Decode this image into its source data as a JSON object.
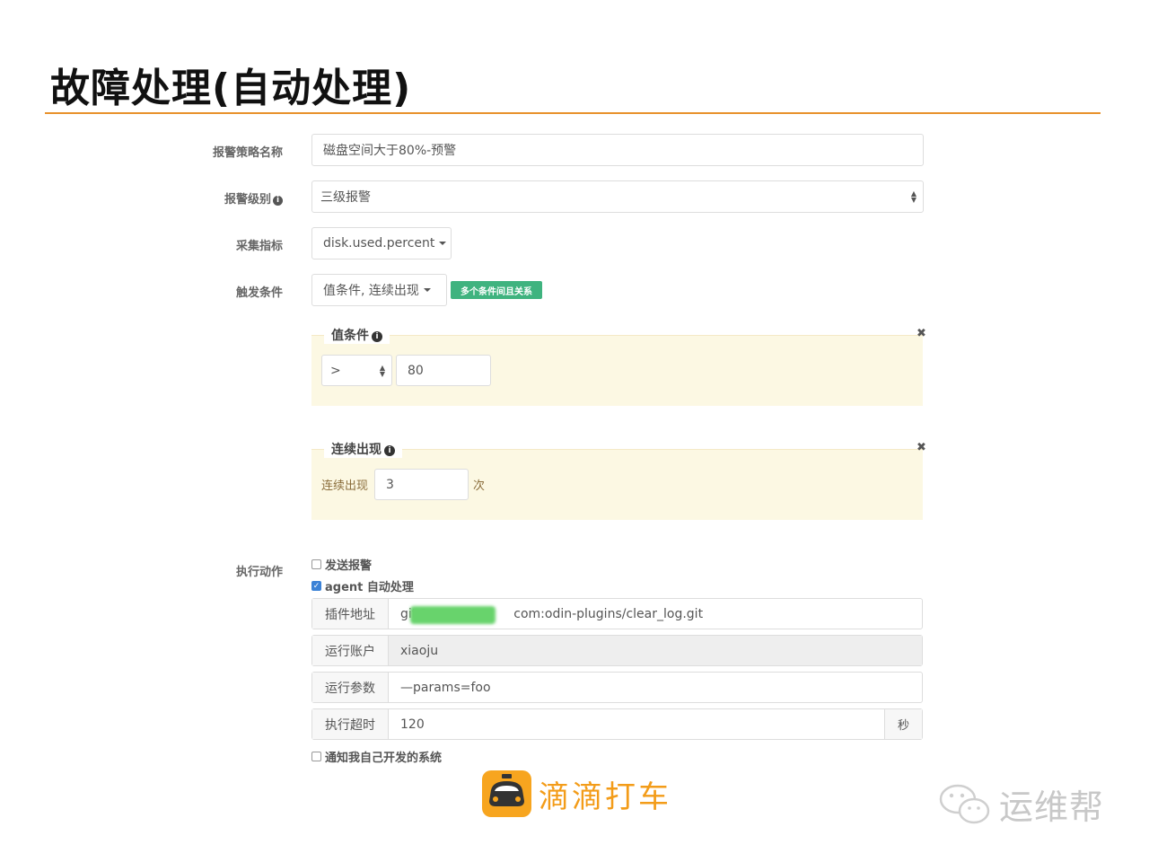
{
  "slide": {
    "title": "故障处理(自动处理)"
  },
  "form": {
    "policy_name": {
      "label": "报警策略名称",
      "value": "磁盘空间大于80%-预警"
    },
    "alarm_level": {
      "label": "报警级别",
      "value": "三级报警"
    },
    "metric": {
      "label": "采集指标",
      "value": "disk.used.percent"
    },
    "trigger": {
      "label": "触发条件",
      "value": "值条件, 连续出现",
      "badge": "多个条件间且关系"
    },
    "value_condition": {
      "legend": "值条件",
      "operator": ">",
      "threshold": "80"
    },
    "consecutive": {
      "legend": "连续出现",
      "label": "连续出现",
      "count": "3",
      "unit": "次"
    },
    "actions": {
      "label": "执行动作",
      "send_alarm": {
        "label": "发送报警",
        "checked": false
      },
      "agent_auto": {
        "label": "agent 自动处理",
        "checked": true
      },
      "plugin_url": {
        "label": "插件地址",
        "value_prefix": "git@",
        "value_suffix": "com:odin-plugins/clear_log.git"
      },
      "run_account": {
        "label": "运行账户",
        "value": "xiaoju"
      },
      "run_params": {
        "label": "运行参数",
        "value": "—params=foo"
      },
      "timeout": {
        "label": "执行超时",
        "value": "120",
        "unit": "秒"
      },
      "notify_own": {
        "label": "通知我自己开发的系统",
        "checked": false
      }
    }
  },
  "footer": {
    "brand": "滴滴打车",
    "watermark": "运维帮"
  },
  "icons": {
    "info": "info-icon",
    "close": "close-icon",
    "caret": "caret-down-icon",
    "checkmark": "check-icon"
  },
  "colors": {
    "accent_rule": "#e8912b",
    "badge": "#3fb37f",
    "panel_bg": "#fcf8e3",
    "brand": "#f39c19"
  }
}
